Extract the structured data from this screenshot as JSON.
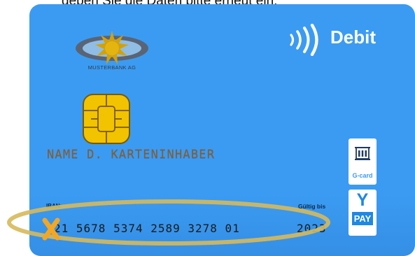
{
  "instruction": "geben Sie die Daten bitte erneut ein.",
  "card": {
    "bank_name": "MUSTERBANK AG",
    "card_type": "Debit",
    "holder_name": "NAME D. KARTENINHABER",
    "iban_caption": "IBAN:",
    "iban_number": "21 5678 5374 2589 3278 01",
    "valid_caption": "Gültig bis",
    "valid_year": "2023",
    "gcard_label": "G-card",
    "pay_y": "Y",
    "pay_label": "PAY"
  },
  "icons": {
    "contactless": "contactless-icon",
    "chip": "chip-icon",
    "logo": "bank-logo-icon",
    "gcard": "building-icon",
    "cross": "cross-mark-icon"
  },
  "colors": {
    "card_blue": "#3b9bf2",
    "chip_gold": "#f2c300",
    "highlight_ellipse": "#d7b95a",
    "cross_mark": "#f5a623",
    "holder_text": "#8a5c2a"
  }
}
